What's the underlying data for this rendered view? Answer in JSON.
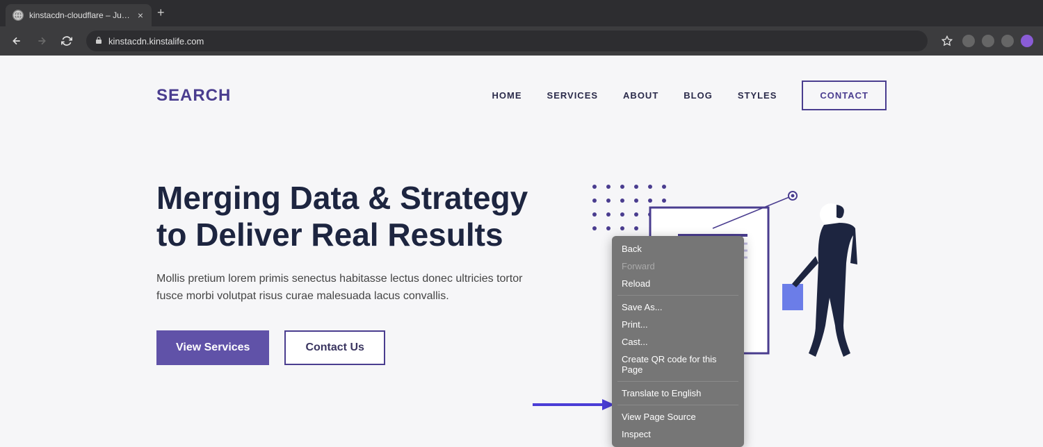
{
  "browser": {
    "tab_title": "kinstacdn-cloudflare – Just an",
    "url": "kinstacdn.kinstalife.com"
  },
  "header": {
    "logo": "SEARCH",
    "nav": [
      "HOME",
      "SERVICES",
      "ABOUT",
      "BLOG",
      "STYLES"
    ],
    "contact": "CONTACT"
  },
  "hero": {
    "title": "Merging Data & Strategy to Deliver Real Results",
    "description": "Mollis pretium lorem primis senectus habitasse lectus donec ultricies tortor fusce morbi volutpat risus curae malesuada lacus convallis.",
    "btn_primary": "View Services",
    "btn_outline": "Contact Us"
  },
  "context_menu": {
    "back": "Back",
    "forward": "Forward",
    "reload": "Reload",
    "save_as": "Save As...",
    "print": "Print...",
    "cast": "Cast...",
    "qr": "Create QR code for this Page",
    "translate": "Translate to English",
    "view_source": "View Page Source",
    "inspect": "Inspect"
  }
}
